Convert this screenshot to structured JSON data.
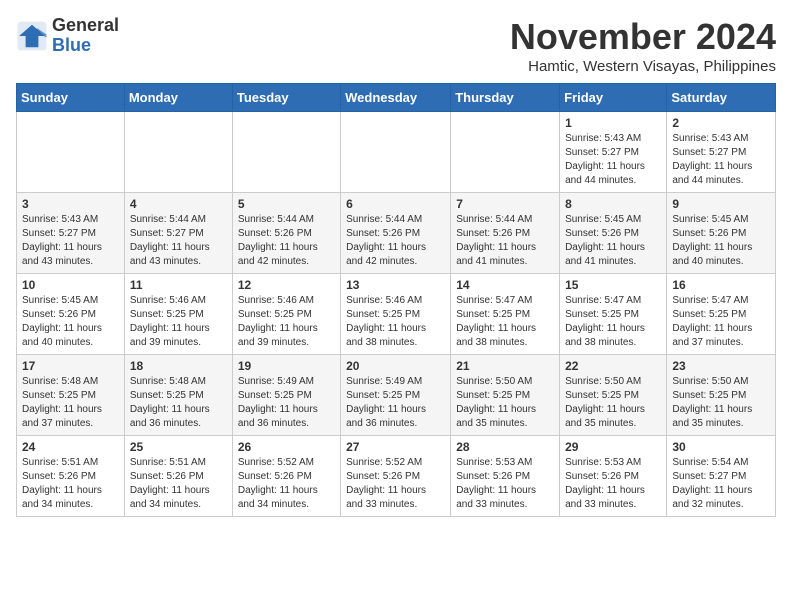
{
  "logo": {
    "general": "General",
    "blue": "Blue"
  },
  "title": "November 2024",
  "subtitle": "Hamtic, Western Visayas, Philippines",
  "weekdays": [
    "Sunday",
    "Monday",
    "Tuesday",
    "Wednesday",
    "Thursday",
    "Friday",
    "Saturday"
  ],
  "weeks": [
    [
      {
        "day": "",
        "info": ""
      },
      {
        "day": "",
        "info": ""
      },
      {
        "day": "",
        "info": ""
      },
      {
        "day": "",
        "info": ""
      },
      {
        "day": "",
        "info": ""
      },
      {
        "day": "1",
        "info": "Sunrise: 5:43 AM\nSunset: 5:27 PM\nDaylight: 11 hours and 44 minutes."
      },
      {
        "day": "2",
        "info": "Sunrise: 5:43 AM\nSunset: 5:27 PM\nDaylight: 11 hours and 44 minutes."
      }
    ],
    [
      {
        "day": "3",
        "info": "Sunrise: 5:43 AM\nSunset: 5:27 PM\nDaylight: 11 hours and 43 minutes."
      },
      {
        "day": "4",
        "info": "Sunrise: 5:44 AM\nSunset: 5:27 PM\nDaylight: 11 hours and 43 minutes."
      },
      {
        "day": "5",
        "info": "Sunrise: 5:44 AM\nSunset: 5:26 PM\nDaylight: 11 hours and 42 minutes."
      },
      {
        "day": "6",
        "info": "Sunrise: 5:44 AM\nSunset: 5:26 PM\nDaylight: 11 hours and 42 minutes."
      },
      {
        "day": "7",
        "info": "Sunrise: 5:44 AM\nSunset: 5:26 PM\nDaylight: 11 hours and 41 minutes."
      },
      {
        "day": "8",
        "info": "Sunrise: 5:45 AM\nSunset: 5:26 PM\nDaylight: 11 hours and 41 minutes."
      },
      {
        "day": "9",
        "info": "Sunrise: 5:45 AM\nSunset: 5:26 PM\nDaylight: 11 hours and 40 minutes."
      }
    ],
    [
      {
        "day": "10",
        "info": "Sunrise: 5:45 AM\nSunset: 5:26 PM\nDaylight: 11 hours and 40 minutes."
      },
      {
        "day": "11",
        "info": "Sunrise: 5:46 AM\nSunset: 5:25 PM\nDaylight: 11 hours and 39 minutes."
      },
      {
        "day": "12",
        "info": "Sunrise: 5:46 AM\nSunset: 5:25 PM\nDaylight: 11 hours and 39 minutes."
      },
      {
        "day": "13",
        "info": "Sunrise: 5:46 AM\nSunset: 5:25 PM\nDaylight: 11 hours and 38 minutes."
      },
      {
        "day": "14",
        "info": "Sunrise: 5:47 AM\nSunset: 5:25 PM\nDaylight: 11 hours and 38 minutes."
      },
      {
        "day": "15",
        "info": "Sunrise: 5:47 AM\nSunset: 5:25 PM\nDaylight: 11 hours and 38 minutes."
      },
      {
        "day": "16",
        "info": "Sunrise: 5:47 AM\nSunset: 5:25 PM\nDaylight: 11 hours and 37 minutes."
      }
    ],
    [
      {
        "day": "17",
        "info": "Sunrise: 5:48 AM\nSunset: 5:25 PM\nDaylight: 11 hours and 37 minutes."
      },
      {
        "day": "18",
        "info": "Sunrise: 5:48 AM\nSunset: 5:25 PM\nDaylight: 11 hours and 36 minutes."
      },
      {
        "day": "19",
        "info": "Sunrise: 5:49 AM\nSunset: 5:25 PM\nDaylight: 11 hours and 36 minutes."
      },
      {
        "day": "20",
        "info": "Sunrise: 5:49 AM\nSunset: 5:25 PM\nDaylight: 11 hours and 36 minutes."
      },
      {
        "day": "21",
        "info": "Sunrise: 5:50 AM\nSunset: 5:25 PM\nDaylight: 11 hours and 35 minutes."
      },
      {
        "day": "22",
        "info": "Sunrise: 5:50 AM\nSunset: 5:25 PM\nDaylight: 11 hours and 35 minutes."
      },
      {
        "day": "23",
        "info": "Sunrise: 5:50 AM\nSunset: 5:25 PM\nDaylight: 11 hours and 35 minutes."
      }
    ],
    [
      {
        "day": "24",
        "info": "Sunrise: 5:51 AM\nSunset: 5:26 PM\nDaylight: 11 hours and 34 minutes."
      },
      {
        "day": "25",
        "info": "Sunrise: 5:51 AM\nSunset: 5:26 PM\nDaylight: 11 hours and 34 minutes."
      },
      {
        "day": "26",
        "info": "Sunrise: 5:52 AM\nSunset: 5:26 PM\nDaylight: 11 hours and 34 minutes."
      },
      {
        "day": "27",
        "info": "Sunrise: 5:52 AM\nSunset: 5:26 PM\nDaylight: 11 hours and 33 minutes."
      },
      {
        "day": "28",
        "info": "Sunrise: 5:53 AM\nSunset: 5:26 PM\nDaylight: 11 hours and 33 minutes."
      },
      {
        "day": "29",
        "info": "Sunrise: 5:53 AM\nSunset: 5:26 PM\nDaylight: 11 hours and 33 minutes."
      },
      {
        "day": "30",
        "info": "Sunrise: 5:54 AM\nSunset: 5:27 PM\nDaylight: 11 hours and 32 minutes."
      }
    ]
  ]
}
